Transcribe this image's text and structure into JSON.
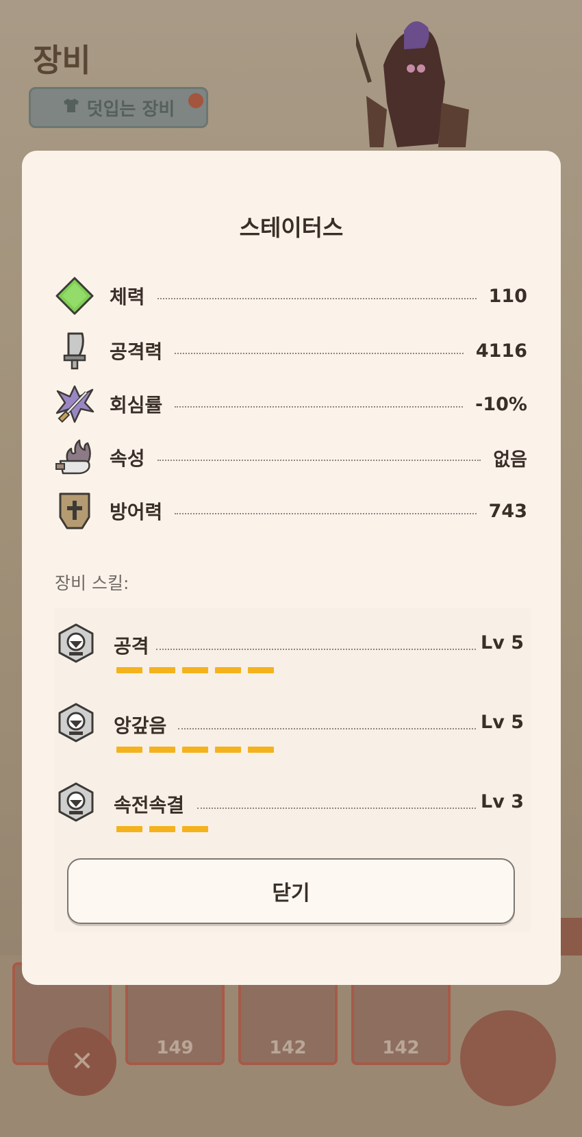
{
  "background": {
    "page_title": "장비",
    "chip_label": "덧입는 장비",
    "card_values": [
      "149",
      "142",
      "142"
    ],
    "close_glyph": "✕"
  },
  "modal": {
    "title": "스테이터스",
    "stats": [
      {
        "label": "체력",
        "value": "110",
        "icon": "stamina-diamond-icon"
      },
      {
        "label": "공격력",
        "value": "4116",
        "icon": "attack-blade-icon"
      },
      {
        "label": "회심률",
        "value": "-10%",
        "icon": "affinity-crossed-swords-icon"
      },
      {
        "label": "속성",
        "value": "없음",
        "icon": "element-flame-icon"
      },
      {
        "label": "방어력",
        "value": "743",
        "icon": "defense-shield-icon"
      }
    ],
    "skills_heading": "장비 스킬:",
    "skills": [
      {
        "name": "공격",
        "level": "Lv 5",
        "level_value": 5
      },
      {
        "name": "앙갚음",
        "level": "Lv 5",
        "level_value": 5
      },
      {
        "name": "속전속결",
        "level": "Lv 3",
        "level_value": 3
      }
    ],
    "close_label": "닫기"
  },
  "colors": {
    "level_bar": "#f4b21c",
    "modal_bg": "#fbf3ea",
    "text": "#3a2f28",
    "stamina_green": "#7fcf55"
  }
}
